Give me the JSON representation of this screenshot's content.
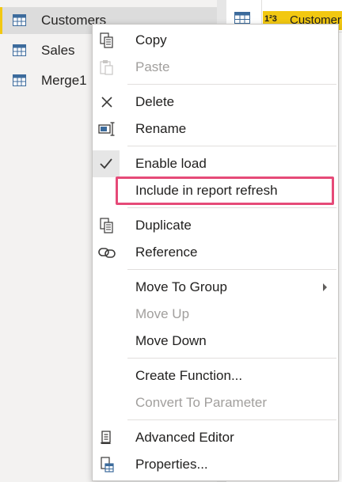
{
  "queries": [
    {
      "label": "Customers",
      "icon": "table-icon",
      "selected": true
    },
    {
      "label": "Sales",
      "icon": "table-icon",
      "selected": false
    },
    {
      "label": "Merge1",
      "icon": "table-icon",
      "selected": false
    }
  ],
  "preview": {
    "column_type": "1²3",
    "column_name": "Customer"
  },
  "menu": {
    "items": {
      "copy": {
        "label": "Copy",
        "icon": "copy-icon",
        "enabled": true
      },
      "paste": {
        "label": "Paste",
        "icon": "paste-icon",
        "enabled": false
      },
      "delete": {
        "label": "Delete",
        "icon": "delete-icon",
        "enabled": true
      },
      "rename": {
        "label": "Rename",
        "icon": "rename-icon",
        "enabled": true
      },
      "enable_load": {
        "label": "Enable load",
        "icon": "checkmark-icon",
        "enabled": true,
        "checked": true
      },
      "include_refresh": {
        "label": "Include in report refresh",
        "enabled": true,
        "highlighted": true
      },
      "duplicate": {
        "label": "Duplicate",
        "icon": "duplicate-icon",
        "enabled": true
      },
      "reference": {
        "label": "Reference",
        "icon": "reference-icon",
        "enabled": true
      },
      "move_to_group": {
        "label": "Move To Group",
        "enabled": true,
        "has_submenu": true
      },
      "move_up": {
        "label": "Move Up",
        "enabled": false
      },
      "move_down": {
        "label": "Move Down",
        "enabled": true
      },
      "create_function": {
        "label": "Create Function...",
        "enabled": true
      },
      "convert_param": {
        "label": "Convert To Parameter",
        "enabled": false
      },
      "advanced_editor": {
        "label": "Advanced Editor",
        "icon": "advanced-editor-icon",
        "enabled": true
      },
      "properties": {
        "label": "Properties...",
        "icon": "properties-icon",
        "enabled": true
      }
    }
  },
  "colors": {
    "accent_yellow": "#f2c811",
    "highlight_border": "#e64a78",
    "disabled_text": "#a19f9d"
  }
}
